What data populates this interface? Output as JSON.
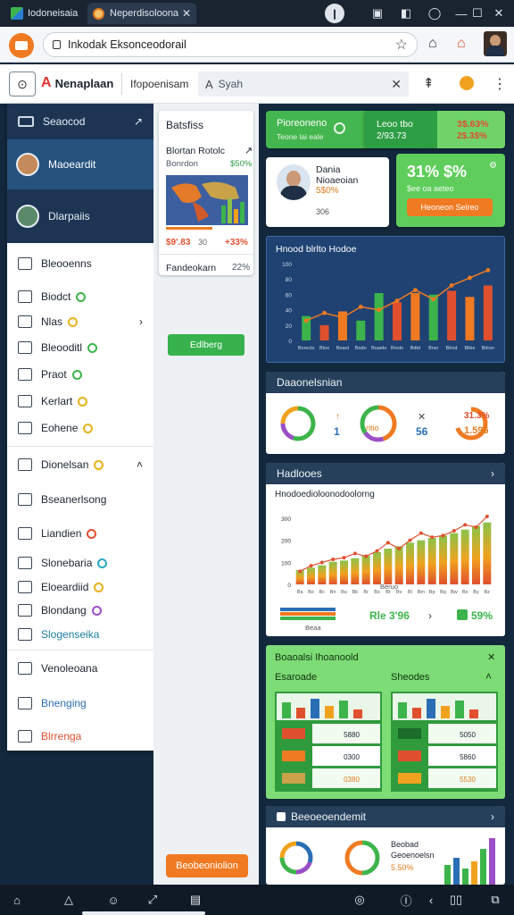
{
  "browser": {
    "tabs": [
      {
        "label": "Iodoneisaia"
      },
      {
        "label": "Neperdisoloona"
      }
    ],
    "url": "Inkodak Eksonceodorail"
  },
  "appbar": {
    "brand": "Nenaplaan",
    "section": "Ifopoenisam",
    "search_placeholder": "Syah"
  },
  "sidebar": {
    "header": "Seaocod",
    "users": [
      {
        "label": "Maoeardit"
      },
      {
        "label": "Dlarpaiis"
      }
    ],
    "items": [
      {
        "label": "Bleooenns",
        "dot": ""
      },
      {
        "label": "Biodct",
        "dot": "#3cb44b"
      },
      {
        "label": "Nlas",
        "dot": "#e8b21c",
        "arrow": "›"
      },
      {
        "label": "Bleooditl",
        "dot": "#3cb44b"
      },
      {
        "label": "Praot",
        "dot": "#3cb44b"
      },
      {
        "label": "Kerlart",
        "dot": "#e8b21c"
      },
      {
        "label": "Eohene",
        "dot": "#e8b21c"
      },
      {
        "label": "Dionelsan",
        "dot": "#e8b21c",
        "arrow": "˄"
      },
      {
        "label": "Bseanerlsong",
        "dot": ""
      },
      {
        "label": "Liandien",
        "dot": "#e0502e"
      },
      {
        "label": "Slonebaria",
        "dot": "#2aa8c7"
      },
      {
        "label": "Eloeardiid",
        "dot": "#e8b21c"
      },
      {
        "label": "Blondang",
        "dot": "#9b4fc6"
      },
      {
        "label": "Slogenseika",
        "dot": ""
      },
      {
        "label": "Venoleoana",
        "dot": ""
      },
      {
        "label": "Bnenging",
        "dot": ""
      },
      {
        "label": "Blrrenga",
        "dot": ""
      }
    ]
  },
  "colcard": {
    "title": "Batsfiss",
    "row_label": "Blortan Rotolc",
    "row_sub": "Bonrdon",
    "row_pct": "$50%",
    "v1": "$9'.83",
    "v1b": "30",
    "v2": "+33%",
    "foot_label": "Fandeokarn",
    "foot_pct": "22%"
  },
  "col_green_btn": "Edlberg",
  "col_orange_btn": "Beobeoniolion",
  "kpi": {
    "a_title": "Pioreoneno",
    "a_sub": "Teone lai eale",
    "b_left_title": "Leoo tbo",
    "b_left_sub": "2/93.73",
    "b_right_title": "3$.63%",
    "b_right_sub": "2$.3$%"
  },
  "profile": {
    "name": "Dania",
    "role": "Nioaeoian",
    "pct": "5$0%",
    "foot": "306"
  },
  "stat": {
    "value": "31% $%",
    "sub": "$ee oa aeteo",
    "button": "Heoneon Selreo"
  },
  "chart1": {
    "title": "Hnood blrlto Hodoe",
    "ticks_y": [
      "100",
      "80",
      "60",
      "40",
      "20",
      "0"
    ],
    "ticks_x": [
      "Boreclo",
      "Bloo",
      "Boaol",
      "Bndo",
      "Boaelo",
      "Bnolo",
      "Bdtd",
      "Bnsr",
      "Blrnd",
      "Blkie",
      "Bdrsn"
    ]
  },
  "chart_data": [
    {
      "type": "bar",
      "title": "Hnood blrlto Hodoe",
      "categories": [
        "Boreclo",
        "Bloo",
        "Boaol",
        "Bndo",
        "Boaelo",
        "Bnolo",
        "Bdtd",
        "Bnsr",
        "Blrnd",
        "Blkie",
        "Bdrsn"
      ],
      "series": [
        {
          "values": [
            32,
            20,
            38,
            26,
            62,
            50,
            62,
            60,
            65,
            57,
            72
          ]
        },
        {
          "values": [
            26,
            36,
            30,
            44,
            40,
            52,
            66,
            54,
            72,
            82,
            92
          ],
          "line": true
        }
      ],
      "ylim": [
        0,
        110
      ]
    },
    {
      "type": "bar",
      "title": "Hnodoedioloonodoolorng",
      "categories": [
        "Ba",
        "Bo",
        "Bc",
        "Bn",
        "Bu",
        "Bk",
        "Br",
        "Bs",
        "Bt",
        "Bv",
        "Bl",
        "Bm",
        "Bp",
        "Bq",
        "Bw",
        "Bx",
        "By",
        "Bz"
      ],
      "series": [
        {
          "values": [
            60,
            70,
            80,
            95,
            100,
            110,
            120,
            135,
            150,
            160,
            175,
            185,
            195,
            205,
            215,
            230,
            245,
            260
          ]
        },
        {
          "values": [
            55,
            78,
            92,
            105,
            112,
            130,
            118,
            140,
            175,
            150,
            185,
            215,
            198,
            205,
            225,
            250,
            240,
            285
          ],
          "line": true
        }
      ],
      "ylim": [
        0,
        300
      ]
    }
  ],
  "donuts": {
    "title": "Daaonelsnian",
    "items": [
      {
        "label": "",
        "value": ""
      },
      {
        "label": "1",
        "value": ""
      },
      {
        "label": "ritio",
        "value": ""
      },
      {
        "label": "56",
        "value": ""
      },
      {
        "label": "1.596",
        "value": "31.3%"
      }
    ]
  },
  "chart2": {
    "header": "Hadlooes",
    "title": "Hnodoedioloonodoolorng",
    "ticks_y": [
      "300",
      "200",
      "100",
      "0"
    ],
    "footer": "Beruo",
    "sub": "Beaa",
    "kpi1": "Rle 3'96",
    "kpi2": "59%"
  },
  "green_panel": {
    "title": "Boaoalsi Ihoanoold",
    "left_title": "Esaroade",
    "right_title": "Sheodes",
    "left_cells": [
      "5880",
      "0300",
      "0380"
    ],
    "right_cells": [
      "5050",
      "5860",
      "5530"
    ]
  },
  "bottom_panel": {
    "title": "Beeoeoendemit",
    "t1": "Beobad",
    "t2": "Geoenoelsn",
    "t3": "5.50%"
  }
}
